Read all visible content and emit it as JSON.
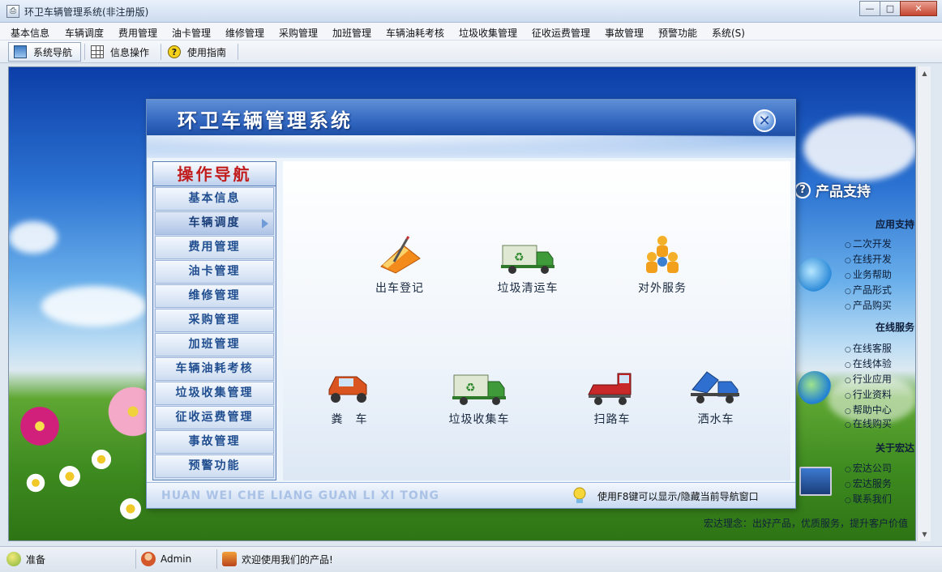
{
  "window": {
    "title": "环卫车辆管理系统(非注册版)",
    "buttons": {
      "minimize": "—",
      "maximize": "□",
      "close": "✕"
    }
  },
  "menubar": {
    "items": [
      "基本信息",
      "车辆调度",
      "费用管理",
      "油卡管理",
      "维修管理",
      "采购管理",
      "加班管理",
      "车辆油耗考核",
      "垃圾收集管理",
      "征收运费管理",
      "事故管理",
      "预警功能",
      "系统(S)"
    ]
  },
  "toolbar": {
    "items": [
      {
        "label": "系统导航",
        "icon": "monitor-icon",
        "active": true
      },
      {
        "label": "信息操作",
        "icon": "grid-icon",
        "active": false
      },
      {
        "label": "使用指南",
        "icon": "help-icon",
        "active": false
      }
    ]
  },
  "dialog": {
    "title": "环卫车辆管理系统",
    "close_glyph": "✕",
    "nav": {
      "title": "操作导航",
      "items": [
        "基本信息",
        "车辆调度",
        "费用管理",
        "油卡管理",
        "维修管理",
        "采购管理",
        "加班管理",
        "车辆油耗考核",
        "垃圾收集管理",
        "征收运费管理",
        "事故管理",
        "预警功能"
      ],
      "selected": "车辆调度"
    },
    "features": [
      {
        "label": "出车登记",
        "icon": "dispatch-register-icon"
      },
      {
        "label": "垃圾清运车",
        "icon": "garbage-truck-icon"
      },
      {
        "label": "对外服务",
        "icon": "external-service-icon"
      },
      {
        "label": "粪　车",
        "icon": "manure-truck-icon"
      },
      {
        "label": "垃圾收集车",
        "icon": "garbage-collection-truck-icon"
      },
      {
        "label": "扫路车",
        "icon": "street-sweeper-icon"
      },
      {
        "label": "洒水车",
        "icon": "sprinkler-truck-icon"
      }
    ],
    "footer": {
      "pinyin": "HUAN WEI CHE LIANG GUAN LI XI TONG",
      "hint": "使用F8键可以显示/隐藏当前导航窗口"
    }
  },
  "support_panel": {
    "title": "产品支持",
    "sections": [
      {
        "title": "应用支持",
        "links": [
          "二次开发",
          "在线开发",
          "业务帮助",
          "产品形式",
          "产品购买"
        ]
      },
      {
        "title": "在线服务",
        "links": [
          "在线客服",
          "在线体验",
          "行业应用",
          "行业资料",
          "帮助中心",
          "在线购买"
        ]
      },
      {
        "title": "关于宏达",
        "links": [
          "宏达公司",
          "宏达服务",
          "联系我们"
        ]
      }
    ],
    "slogan": "宏达理念：出好产品，优质服务，提升客户价值"
  },
  "statusbar": {
    "ready": "准备",
    "user": "Admin",
    "welcome": "欢迎使用我们的产品!"
  },
  "colors": {
    "accent": "#2f64be",
    "nav_text": "#1f4d8f",
    "nav_title": "#c11d1d"
  }
}
